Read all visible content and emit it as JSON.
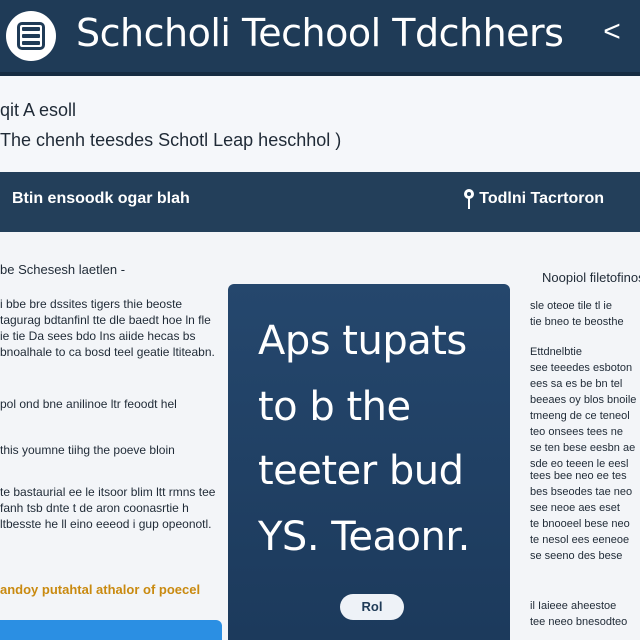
{
  "header": {
    "title": "Schcholi Techool Tdchhers",
    "menu_icon": "menu-icon",
    "back_label": "<"
  },
  "intro": {
    "title": "qit A esoll",
    "subtitle": "The chenh teesdes Schotl Leap heschhol )"
  },
  "subbar": {
    "left_label": "Btin ensoodk ogar blah",
    "right_label": "Todlni Tacrtoron",
    "pin_icon": "location-pin-icon"
  },
  "left_column": {
    "heading": "be Schesesh laetlen -",
    "paragraphs": [
      "i bbe bre dssites tigers thie beoste tagurag bdtanfinl tte dle baedt hoe ln fle ie tie Da sees bdo Ins aiide hecas bs bnoalhale to ca bosd teel geatie ltiteabn.",
      "pol ond bne anilinoe ltr feoodt hel",
      "this youmne tiihg the poeve bloin",
      "te bastaurial ee le itsoor blim ltt rmns tee fanh tsb dnte t de aron coonasrtie h ltbesste he ll eino eeeod i gup opeonotl."
    ],
    "highlight": "andoy putahtal athalor of poecel"
  },
  "hero": {
    "lines": [
      "Aps tupats",
      "to b the",
      "teeter bud",
      "YS. Teaonr."
    ],
    "button_label": "Rol"
  },
  "right_column": {
    "heading": "Noopiol filetofinos",
    "paragraphs": [
      "sle oteoe tile tl ie\ntie bneo te beosthe",
      "Ettdnelbtie\nsee teeedes esboton\nees sa es be bn tel\nbeeaes oy blos bnoile\ntmeeng de ce teneol\nteo onsees tees ne\nse ten bese eesbn ae\nsde eo teeen le eesl",
      "tees bee neo ee tes\nbes bseodes tae neo\nsee neoe aes eset\nte bnooeel bese neo\nte nesol ees eeneoe\nse seeno des bese",
      "il Iaieee aheestoe\ntee neeo bnesodteo"
    ]
  }
}
